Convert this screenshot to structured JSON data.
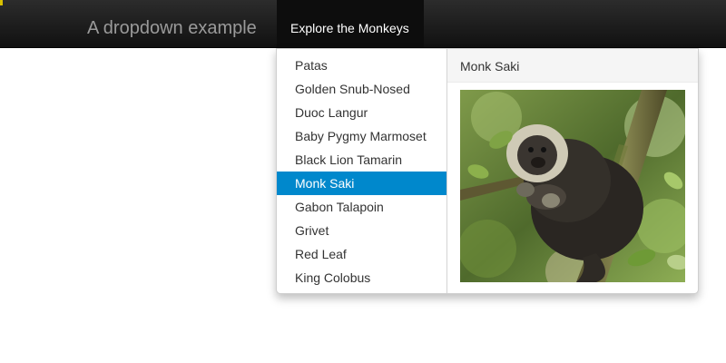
{
  "navbar": {
    "brand": "A dropdown example",
    "nav_item": "Explore the Monkeys"
  },
  "dropdown": {
    "items": [
      "Patas",
      "Golden Snub-Nosed",
      "Duoc Langur",
      "Baby Pygmy Marmoset",
      "Black Lion Tamarin",
      "Monk Saki",
      "Gabon Talapoin",
      "Grivet",
      "Red Leaf",
      "King Colobus"
    ],
    "active_item": "Monk Saki"
  },
  "panel": {
    "title": "Monk Saki",
    "image_subject": "monk-saki-photo"
  },
  "colors": {
    "navbar_bg": "#1b1b1b",
    "active_bg": "#0088cc",
    "brand_text": "#9a9a9a"
  }
}
